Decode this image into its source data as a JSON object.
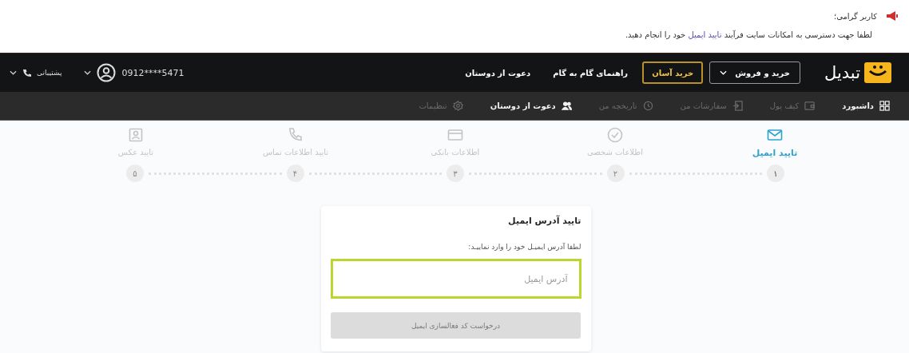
{
  "notice": {
    "title": "کاربر گرامی؛",
    "message": {
      "before": "لطفا جهت دسترسی به امکانات سایت فرآیند",
      "link": "تایید ایمیل",
      "after": "خود را انجام دهید."
    }
  },
  "header": {
    "logo": "تبدیل",
    "buttons": [
      {
        "kind": "dropdown",
        "label": "خرید و فروش"
      },
      {
        "kind": "highlight",
        "label": "خرید آسان"
      },
      {
        "kind": "link",
        "label": "راهنمای گام به گام"
      },
      {
        "kind": "link",
        "label": "دعوت از دوستان"
      }
    ],
    "user": {
      "phone": "0912****5471"
    },
    "support": {
      "label": "پشتیبانی"
    }
  },
  "subnav": [
    {
      "label": "داشبورد",
      "disabled": false
    },
    {
      "label": "کیف پول",
      "disabled": true
    },
    {
      "label": "سفارشات من",
      "disabled": true
    },
    {
      "label": "تاریخچه من",
      "disabled": true
    },
    {
      "label": "دعوت از دوستان",
      "disabled": false
    },
    {
      "label": "تنظیمات",
      "disabled": true
    }
  ],
  "steps": [
    {
      "label": "تایید ایمیل",
      "number": "۱",
      "selected": true
    },
    {
      "label": "اطلاعات شخصی",
      "number": "۲",
      "selected": false
    },
    {
      "label": "اطلاعات بانکی",
      "number": "۳",
      "selected": false
    },
    {
      "label": "تایید اطلاعات تماس",
      "number": "۴",
      "selected": false
    },
    {
      "label": "تایید عکس",
      "number": "۵",
      "selected": false
    }
  ],
  "card": {
    "title": "تایید آدرس ایمیل",
    "hint": "لطفا آدرس ایمیـل خود را وارد نماییـد:",
    "email": {
      "placeholder": "آدرس ایمیل"
    },
    "submit": {
      "label": "درخواست کد فعالسازی ایمیل",
      "disabled": true
    }
  }
}
